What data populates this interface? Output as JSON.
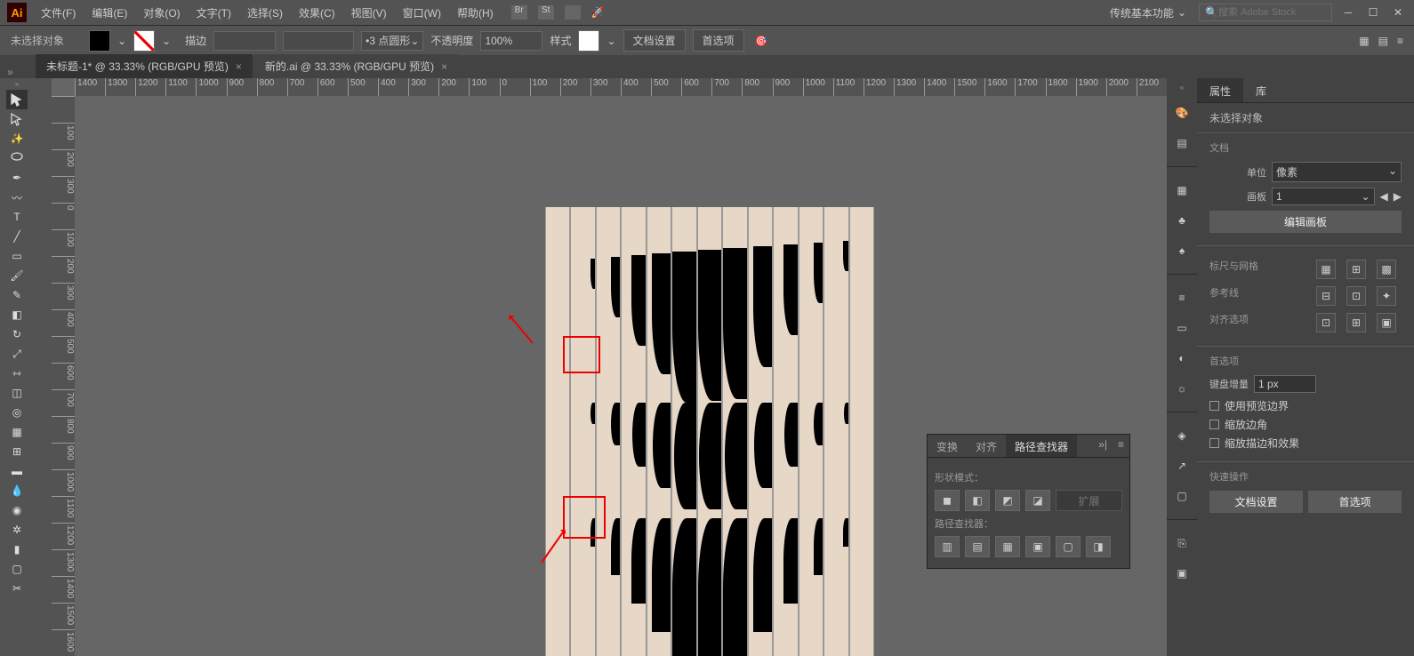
{
  "menu": {
    "file": "文件(F)",
    "edit": "编辑(E)",
    "object": "对象(O)",
    "text": "文字(T)",
    "select": "选择(S)",
    "effect": "效果(C)",
    "view": "视图(V)",
    "window": "窗口(W)",
    "help": "帮助(H)"
  },
  "workspace": "传统基本功能",
  "search_ph": "搜索 Adobe Stock",
  "control": {
    "nosel": "未选择对象",
    "stroke_lbl": "描边",
    "stroke_type": "3 点圆形",
    "opacity_lbl": "不透明度",
    "opacity_val": "100%",
    "style_lbl": "样式",
    "docsetup": "文档设置",
    "prefs": "首选项"
  },
  "tabs": [
    {
      "name": "未标题-1* @ 33.33% (RGB/GPU 预览)"
    },
    {
      "name": "新的.ai @ 33.33% (RGB/GPU 预览)"
    }
  ],
  "hruler": [
    "1400",
    "1300",
    "1200",
    "1100",
    "1000",
    "900",
    "800",
    "700",
    "600",
    "500",
    "400",
    "300",
    "200",
    "100",
    "0",
    "100",
    "200",
    "300",
    "400",
    "500",
    "600",
    "700",
    "800",
    "900",
    "1000",
    "1100",
    "1200",
    "1300",
    "1400",
    "1500",
    "1600",
    "1700",
    "1800",
    "1900",
    "2000",
    "2100"
  ],
  "vruler": [
    "",
    "100",
    "200",
    "300",
    "0",
    "100",
    "200",
    "300",
    "400",
    "500",
    "600",
    "700",
    "800",
    "900",
    "1000",
    "1100",
    "1200",
    "1300",
    "1400",
    "1500",
    "1600"
  ],
  "props": {
    "tab_props": "属性",
    "tab_lib": "库",
    "nosel": "未选择对象",
    "doc": "文档",
    "unit_lbl": "单位",
    "unit_val": "像素",
    "artboard_lbl": "画板",
    "artboard_val": "1",
    "edit_artboard": "编辑画板",
    "rulers": "标尺与网格",
    "guides": "参考线",
    "snap": "对齐选项",
    "prefs": "首选项",
    "kbd_lbl": "键盘增量",
    "kbd_val": "1 px",
    "cb1": "使用预览边界",
    "cb2": "缩放边角",
    "cb3": "缩放描边和效果",
    "quick": "快速操作",
    "q1": "文档设置",
    "q2": "首选项"
  },
  "pf": {
    "t1": "变换",
    "t2": "对齐",
    "t3": "路径查找器",
    "shape": "形状模式：",
    "expand": "扩展",
    "pathf": "路径查找器："
  }
}
